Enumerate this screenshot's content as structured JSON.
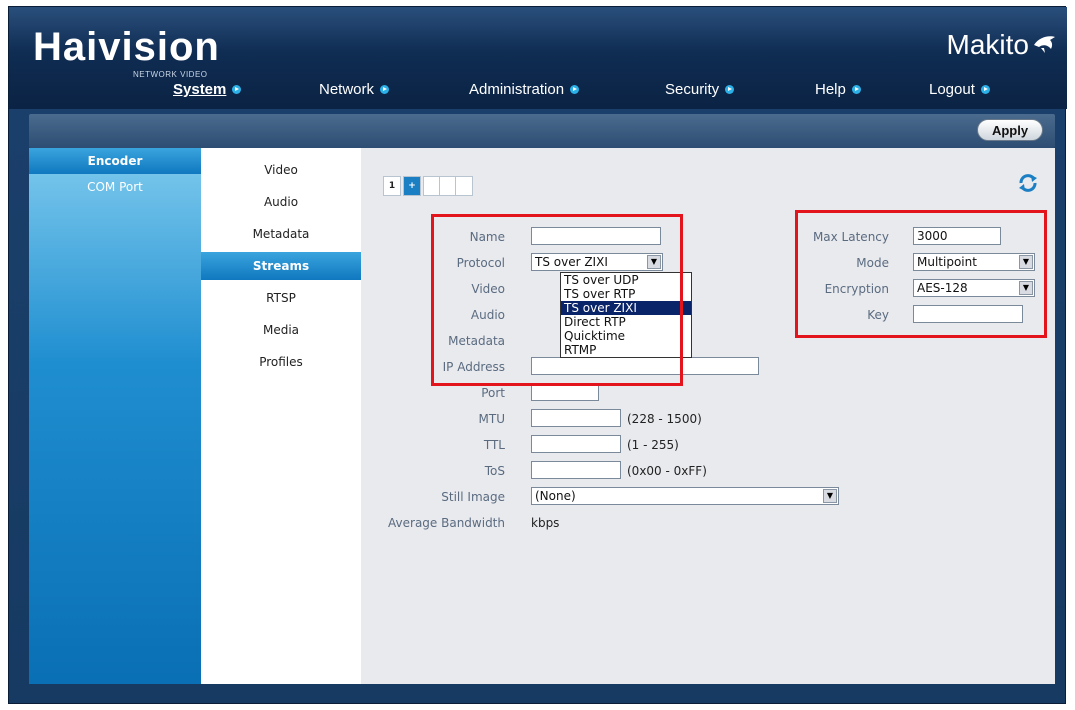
{
  "header": {
    "logo": "Haivision",
    "logo_sub": "NETWORK VIDEO",
    "brand": "Makito"
  },
  "nav": [
    {
      "label": "System",
      "active": true
    },
    {
      "label": "Network"
    },
    {
      "label": "Administration"
    },
    {
      "label": "Security"
    },
    {
      "label": "Help"
    },
    {
      "label": "Logout"
    }
  ],
  "toolbar": {
    "apply_label": "Apply"
  },
  "leftnav": [
    {
      "label": "Encoder",
      "active": true
    },
    {
      "label": "COM Port"
    }
  ],
  "subnav": [
    {
      "label": "Video"
    },
    {
      "label": "Audio"
    },
    {
      "label": "Metadata"
    },
    {
      "label": "Streams",
      "active": true
    },
    {
      "label": "RTSP"
    },
    {
      "label": "Media"
    },
    {
      "label": "Profiles"
    }
  ],
  "stream_tabs": {
    "first": "1",
    "add": "+"
  },
  "form": {
    "name_label": "Name",
    "name_value": "",
    "protocol_label": "Protocol",
    "protocol_value": "TS over ZIXI",
    "video_label": "Video",
    "audio_label": "Audio",
    "metadata_label": "Metadata",
    "ip_label": "IP Address",
    "ip_value": "",
    "port_label": "Port",
    "port_value": "",
    "mtu_label": "MTU",
    "mtu_value": "",
    "mtu_hint": "(228 - 1500)",
    "ttl_label": "TTL",
    "ttl_value": "",
    "ttl_hint": "(1 - 255)",
    "tos_label": "ToS",
    "tos_value": "",
    "tos_hint": "(0x00 - 0xFF)",
    "still_label": "Still Image",
    "still_value": "(None)",
    "bw_label": "Average Bandwidth",
    "bw_value": "kbps"
  },
  "protocol_options": [
    "TS over UDP",
    "TS over RTP",
    "TS over ZIXI",
    "Direct RTP",
    "Quicktime",
    "RTMP"
  ],
  "protocol_selected_index": 2,
  "zixi": {
    "latency_label": "Max Latency",
    "latency_value": "3000",
    "mode_label": "Mode",
    "mode_value": "Multipoint",
    "enc_label": "Encryption",
    "enc_value": "AES-128",
    "key_label": "Key",
    "key_value": ""
  },
  "colors": {
    "highlight": "#e3141c",
    "accent": "#1b7fc4",
    "header_bg": "#0f2c52"
  }
}
